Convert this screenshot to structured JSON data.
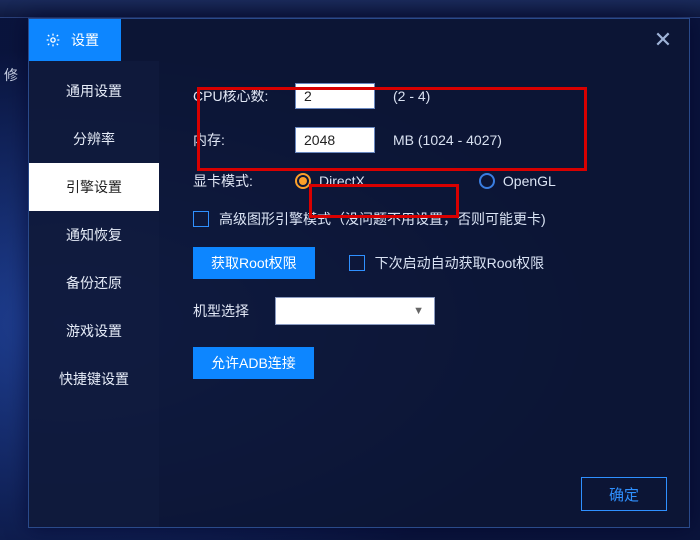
{
  "bg_side_char": "修",
  "titlebar": {
    "title": "设置"
  },
  "sidebar": {
    "items": [
      {
        "label": "通用设置"
      },
      {
        "label": "分辨率"
      },
      {
        "label": "引擎设置"
      },
      {
        "label": "通知恢复"
      },
      {
        "label": "备份还原"
      },
      {
        "label": "游戏设置"
      },
      {
        "label": "快捷键设置"
      }
    ],
    "active_index": 2
  },
  "engine": {
    "cpu_label": "CPU核心数:",
    "cpu_value": "2",
    "cpu_range": "(2 - 4)",
    "mem_label": "内存:",
    "mem_value": "2048",
    "mem_unit_range": "MB   (1024 - 4027)",
    "gpu_mode_label": "显卡模式:",
    "gpu_option_directx": "DirectX",
    "gpu_option_opengl": "OpenGL",
    "gpu_selected": "DirectX",
    "adv_engine_label": "高级图形引擎模式（没问题不用设置，否则可能更卡)",
    "root_btn": "获取Root权限",
    "auto_root_label": "下次启动自动获取Root权限",
    "model_label": "机型选择",
    "model_value": "",
    "adb_btn": "允许ADB连接"
  },
  "footer": {
    "ok": "确定"
  }
}
